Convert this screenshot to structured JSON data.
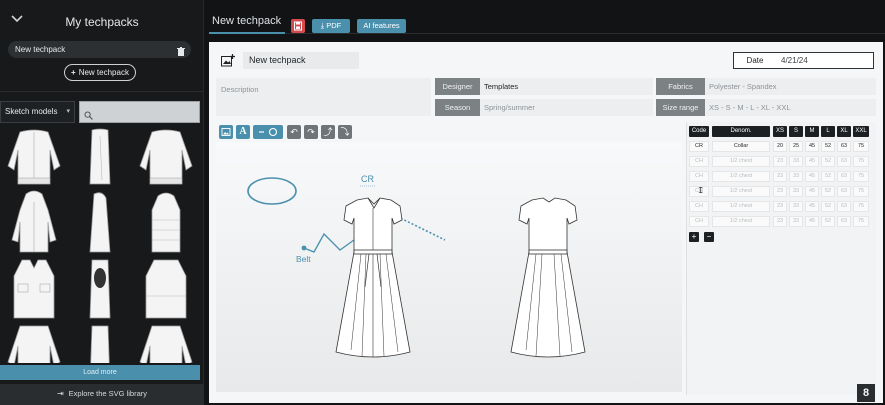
{
  "sidebar": {
    "title": "My techpacks",
    "techpack_item": "New techpack",
    "new_button": "New techpack",
    "sketch_select": "Sketch models",
    "load_more": "Load more",
    "explore": "Explore the SVG library"
  },
  "topbar": {
    "tab": "New techpack",
    "pdf": "PDF",
    "ai": "AI features"
  },
  "card": {
    "name": "New techpack",
    "date_label": "Date",
    "date_value": "4/21/24",
    "description_placeholder": "Description",
    "designer_label": "Designer",
    "designer_value": "Templates",
    "season_label": "Season",
    "season_placeholder": "Spring/summer",
    "fabrics_label": "Fabrics",
    "fabrics_placeholder": "Polyester - Spandex",
    "size_range_label": "Size range",
    "size_range_placeholder": "XS - S - M - L - XL - XXL"
  },
  "canvas": {
    "label_cr": "CR",
    "label_belt": "Belt"
  },
  "table": {
    "headers": [
      "Code",
      "Denom.",
      "XS",
      "S",
      "M",
      "L",
      "XL",
      "XXL"
    ],
    "rows": [
      [
        "CR",
        "Collar",
        "20",
        "25",
        "45",
        "52",
        "63",
        "75"
      ],
      [
        "CH",
        "1/2 chest",
        "23",
        "33",
        "45",
        "52",
        "63",
        "75"
      ],
      [
        "CH",
        "1/2 chest",
        "23",
        "33",
        "45",
        "52",
        "63",
        "75"
      ],
      [
        "CH",
        "1/2 chest",
        "23",
        "33",
        "45",
        "52",
        "63",
        "75"
      ],
      [
        "CH",
        "1/2 chest",
        "23",
        "33",
        "45",
        "52",
        "63",
        "75"
      ],
      [
        "CH",
        "1/2 chest",
        "23",
        "33",
        "45",
        "52",
        "63",
        "75"
      ]
    ],
    "add_label": "+",
    "remove_label": "−"
  },
  "logo": "8",
  "colors": {
    "accent": "#4a90ad",
    "save": "#d34a4f",
    "dark": "#111315"
  },
  "icons": [
    "chevron-down-icon",
    "trash-icon",
    "plus-icon",
    "search-icon",
    "download-icon",
    "save-icon",
    "image-icon",
    "text-icon",
    "line-icon",
    "undo-icon",
    "redo-icon",
    "bring-forward-icon",
    "send-backward-icon",
    "text-cursor-icon",
    "book-icon"
  ]
}
